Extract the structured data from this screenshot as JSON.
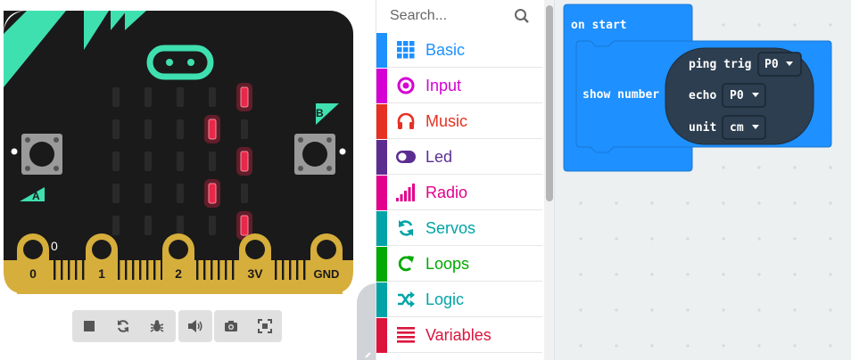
{
  "simulator": {
    "pins": [
      "0",
      "1",
      "2",
      "3V",
      "GND"
    ],
    "pin_readout": "0",
    "button_a_label": "A",
    "button_b_label": "B",
    "led_matrix": [
      [
        0,
        0,
        0,
        0,
        1
      ],
      [
        0,
        0,
        0,
        1,
        0
      ],
      [
        0,
        0,
        0,
        0,
        1
      ],
      [
        0,
        0,
        0,
        1,
        0
      ],
      [
        0,
        0,
        0,
        0,
        1
      ]
    ],
    "toolbar": [
      {
        "name": "stop-icon"
      },
      {
        "name": "restart-icon"
      },
      {
        "name": "debug-icon"
      },
      {
        "name": "sound-icon"
      },
      {
        "name": "screenshot-icon"
      },
      {
        "name": "fullscreen-icon"
      }
    ],
    "colors": {
      "board": "#1a1a1a",
      "accent": "#3fe0b0",
      "gold": "#d6ae3b",
      "led_on": "#e8284a",
      "led_off": "#2a2a2a"
    }
  },
  "toolbox": {
    "search_placeholder": "Search...",
    "categories": [
      {
        "label": "Basic",
        "color": "#1e90ff",
        "icon": "grid-icon"
      },
      {
        "label": "Input",
        "color": "#d400d4",
        "icon": "radio-button-icon"
      },
      {
        "label": "Music",
        "color": "#e63022",
        "icon": "headphones-icon"
      },
      {
        "label": "Led",
        "color": "#5c2d91",
        "icon": "toggle-icon"
      },
      {
        "label": "Radio",
        "color": "#e3008c",
        "icon": "signal-bars-icon"
      },
      {
        "label": "Servos",
        "color": "#00a4a6",
        "icon": "rotate-icon"
      },
      {
        "label": "Loops",
        "color": "#00aa00",
        "icon": "loop-icon"
      },
      {
        "label": "Logic",
        "color": "#00a4a6",
        "icon": "shuffle-icon"
      },
      {
        "label": "Variables",
        "color": "#dc143c",
        "icon": "list-icon"
      }
    ]
  },
  "workspace": {
    "on_start_label": "on start",
    "show_number_label": "show number",
    "ping_label": "ping trig",
    "trig_value": "P0",
    "echo_label": "echo",
    "echo_value": "P0",
    "unit_label": "unit",
    "unit_value": "cm",
    "colors": {
      "event_block": "#1e90ff",
      "sensor_block": "#2c3e50"
    }
  }
}
